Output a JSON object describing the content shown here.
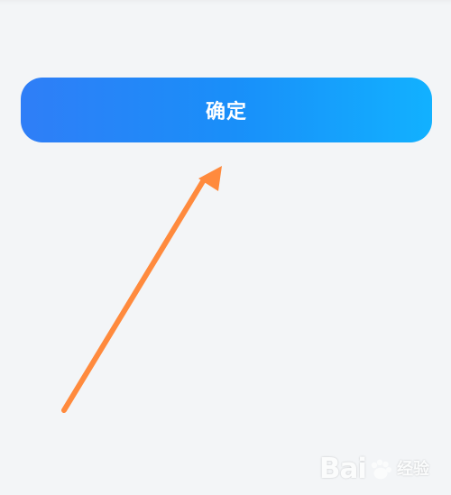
{
  "window": {
    "background_color": "#f3f5f7"
  },
  "confirm_button": {
    "label": "确定",
    "gradient_start": "#2f7ef7",
    "gradient_end": "#12b1ff",
    "text_color": "#ffffff"
  },
  "annotation": {
    "arrow_color": "#ff8a3d",
    "icon": "arrow-up-right-icon"
  },
  "watermark": {
    "text_left": "Bai",
    "icon": "paw-icon",
    "text_right": "经验"
  }
}
